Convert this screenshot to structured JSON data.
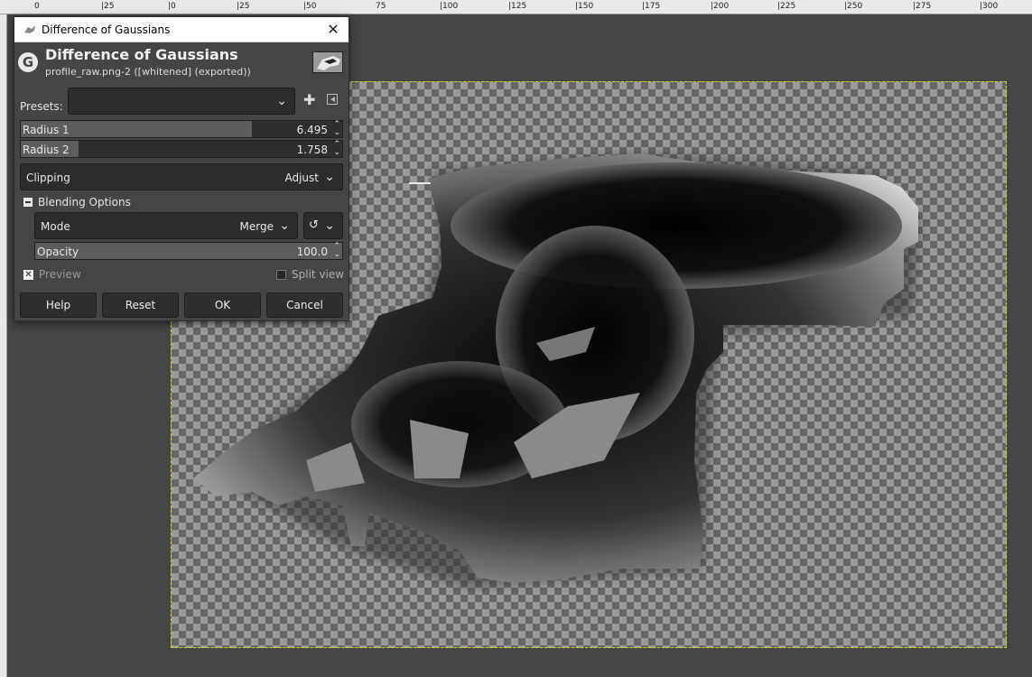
{
  "ruler": {
    "labels": [
      "0",
      "|25",
      "|0",
      "|25",
      "|50",
      "75",
      "|100",
      "|125",
      "|150",
      "|175",
      "|200",
      "|225",
      "|250",
      "|275",
      "|300"
    ]
  },
  "dialog": {
    "window_title": "Difference of Gaussians",
    "heading": "Difference of Gaussians",
    "subheading": "profile_raw.png-2 ([whitened] (exported))",
    "presets_label": "Presets:",
    "presets_value": "",
    "radius1": {
      "label": "Radius 1",
      "value": "6.495",
      "fraction": 0.72
    },
    "radius2": {
      "label": "Radius 2",
      "value": "1.758",
      "fraction": 0.18
    },
    "clipping": {
      "label": "Clipping",
      "value": "Adjust"
    },
    "blending_options_label": "Blending Options",
    "mode": {
      "label": "Mode",
      "value": "Merge"
    },
    "opacity": {
      "label": "Opacity",
      "value": "100.0",
      "fraction": 1.0
    },
    "preview_label": "Preview",
    "preview_checked": true,
    "split_view_label": "Split view",
    "split_view_checked": false,
    "buttons": {
      "help": "Help",
      "reset": "Reset",
      "ok": "OK",
      "cancel": "Cancel"
    }
  }
}
